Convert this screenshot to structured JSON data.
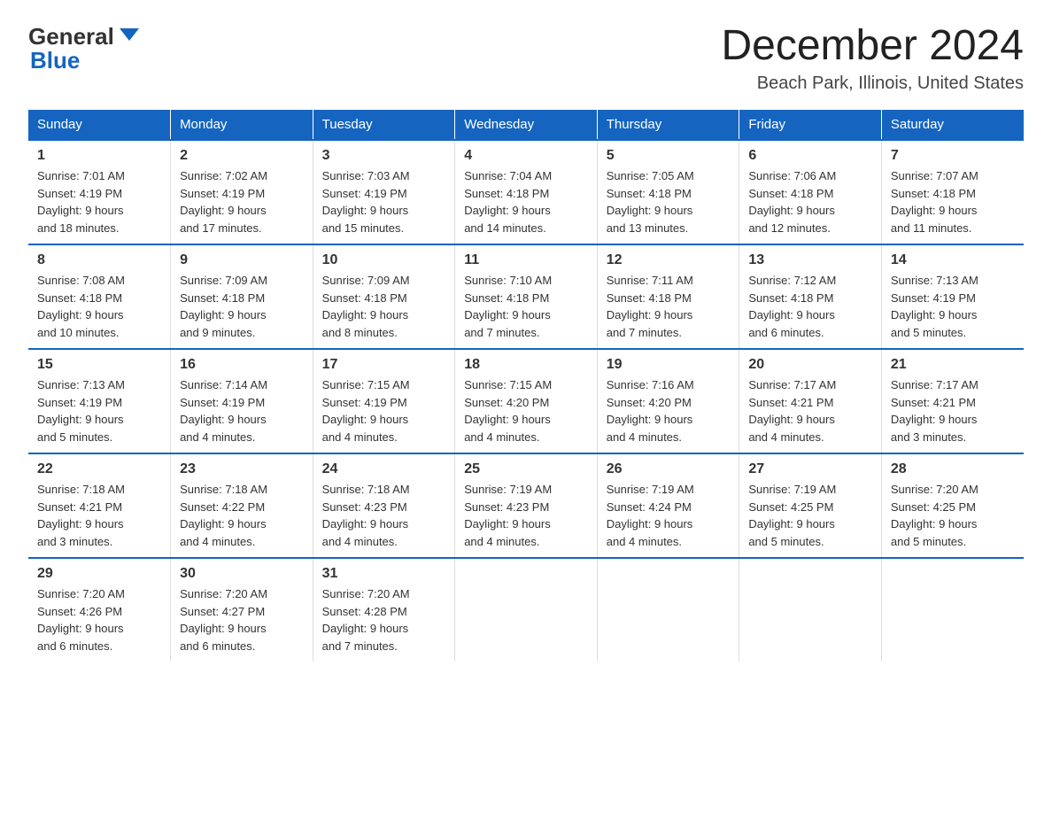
{
  "header": {
    "logo_general": "General",
    "logo_blue": "Blue",
    "month_title": "December 2024",
    "location": "Beach Park, Illinois, United States"
  },
  "weekdays": [
    "Sunday",
    "Monday",
    "Tuesday",
    "Wednesday",
    "Thursday",
    "Friday",
    "Saturday"
  ],
  "weeks": [
    [
      {
        "day": "1",
        "sunrise": "7:01 AM",
        "sunset": "4:19 PM",
        "daylight": "9 hours and 18 minutes."
      },
      {
        "day": "2",
        "sunrise": "7:02 AM",
        "sunset": "4:19 PM",
        "daylight": "9 hours and 17 minutes."
      },
      {
        "day": "3",
        "sunrise": "7:03 AM",
        "sunset": "4:19 PM",
        "daylight": "9 hours and 15 minutes."
      },
      {
        "day": "4",
        "sunrise": "7:04 AM",
        "sunset": "4:18 PM",
        "daylight": "9 hours and 14 minutes."
      },
      {
        "day": "5",
        "sunrise": "7:05 AM",
        "sunset": "4:18 PM",
        "daylight": "9 hours and 13 minutes."
      },
      {
        "day": "6",
        "sunrise": "7:06 AM",
        "sunset": "4:18 PM",
        "daylight": "9 hours and 12 minutes."
      },
      {
        "day": "7",
        "sunrise": "7:07 AM",
        "sunset": "4:18 PM",
        "daylight": "9 hours and 11 minutes."
      }
    ],
    [
      {
        "day": "8",
        "sunrise": "7:08 AM",
        "sunset": "4:18 PM",
        "daylight": "9 hours and 10 minutes."
      },
      {
        "day": "9",
        "sunrise": "7:09 AM",
        "sunset": "4:18 PM",
        "daylight": "9 hours and 9 minutes."
      },
      {
        "day": "10",
        "sunrise": "7:09 AM",
        "sunset": "4:18 PM",
        "daylight": "9 hours and 8 minutes."
      },
      {
        "day": "11",
        "sunrise": "7:10 AM",
        "sunset": "4:18 PM",
        "daylight": "9 hours and 7 minutes."
      },
      {
        "day": "12",
        "sunrise": "7:11 AM",
        "sunset": "4:18 PM",
        "daylight": "9 hours and 7 minutes."
      },
      {
        "day": "13",
        "sunrise": "7:12 AM",
        "sunset": "4:18 PM",
        "daylight": "9 hours and 6 minutes."
      },
      {
        "day": "14",
        "sunrise": "7:13 AM",
        "sunset": "4:19 PM",
        "daylight": "9 hours and 5 minutes."
      }
    ],
    [
      {
        "day": "15",
        "sunrise": "7:13 AM",
        "sunset": "4:19 PM",
        "daylight": "9 hours and 5 minutes."
      },
      {
        "day": "16",
        "sunrise": "7:14 AM",
        "sunset": "4:19 PM",
        "daylight": "9 hours and 4 minutes."
      },
      {
        "day": "17",
        "sunrise": "7:15 AM",
        "sunset": "4:19 PM",
        "daylight": "9 hours and 4 minutes."
      },
      {
        "day": "18",
        "sunrise": "7:15 AM",
        "sunset": "4:20 PM",
        "daylight": "9 hours and 4 minutes."
      },
      {
        "day": "19",
        "sunrise": "7:16 AM",
        "sunset": "4:20 PM",
        "daylight": "9 hours and 4 minutes."
      },
      {
        "day": "20",
        "sunrise": "7:17 AM",
        "sunset": "4:21 PM",
        "daylight": "9 hours and 4 minutes."
      },
      {
        "day": "21",
        "sunrise": "7:17 AM",
        "sunset": "4:21 PM",
        "daylight": "9 hours and 3 minutes."
      }
    ],
    [
      {
        "day": "22",
        "sunrise": "7:18 AM",
        "sunset": "4:21 PM",
        "daylight": "9 hours and 3 minutes."
      },
      {
        "day": "23",
        "sunrise": "7:18 AM",
        "sunset": "4:22 PM",
        "daylight": "9 hours and 4 minutes."
      },
      {
        "day": "24",
        "sunrise": "7:18 AM",
        "sunset": "4:23 PM",
        "daylight": "9 hours and 4 minutes."
      },
      {
        "day": "25",
        "sunrise": "7:19 AM",
        "sunset": "4:23 PM",
        "daylight": "9 hours and 4 minutes."
      },
      {
        "day": "26",
        "sunrise": "7:19 AM",
        "sunset": "4:24 PM",
        "daylight": "9 hours and 4 minutes."
      },
      {
        "day": "27",
        "sunrise": "7:19 AM",
        "sunset": "4:25 PM",
        "daylight": "9 hours and 5 minutes."
      },
      {
        "day": "28",
        "sunrise": "7:20 AM",
        "sunset": "4:25 PM",
        "daylight": "9 hours and 5 minutes."
      }
    ],
    [
      {
        "day": "29",
        "sunrise": "7:20 AM",
        "sunset": "4:26 PM",
        "daylight": "9 hours and 6 minutes."
      },
      {
        "day": "30",
        "sunrise": "7:20 AM",
        "sunset": "4:27 PM",
        "daylight": "9 hours and 6 minutes."
      },
      {
        "day": "31",
        "sunrise": "7:20 AM",
        "sunset": "4:28 PM",
        "daylight": "9 hours and 7 minutes."
      },
      null,
      null,
      null,
      null
    ]
  ],
  "labels": {
    "sunrise": "Sunrise:",
    "sunset": "Sunset:",
    "daylight": "Daylight:"
  }
}
